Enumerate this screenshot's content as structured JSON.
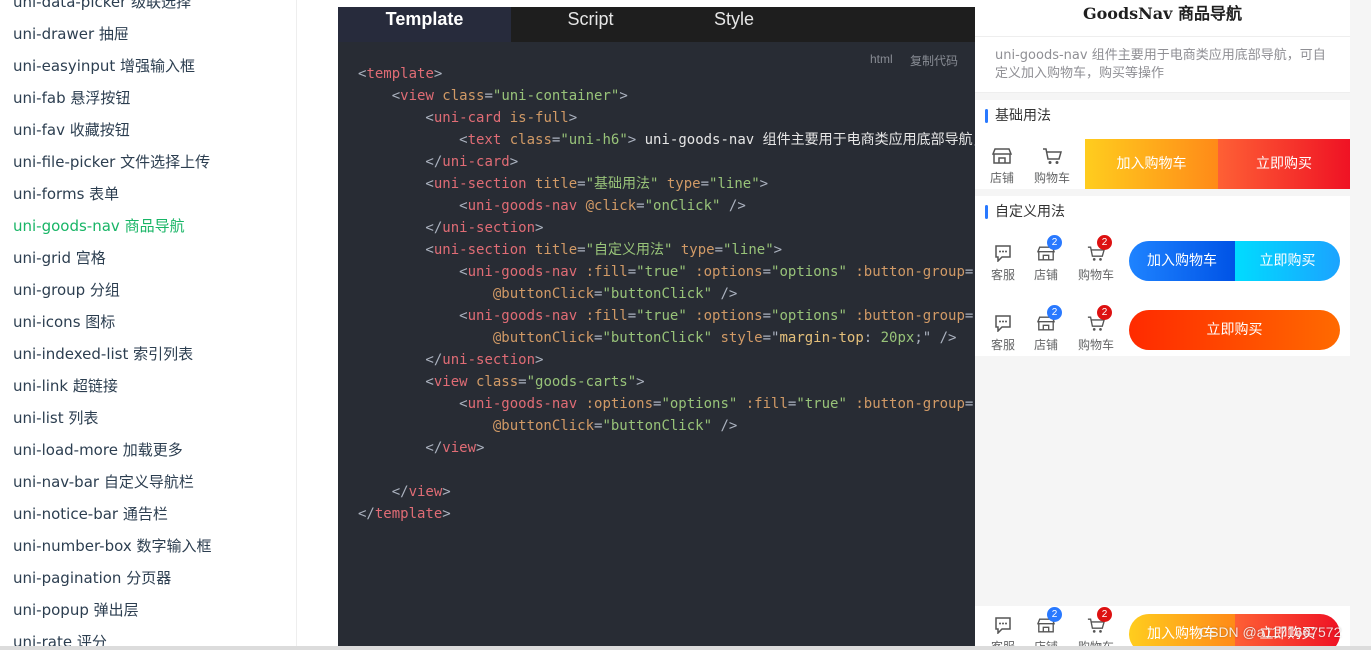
{
  "sidebar": {
    "items": [
      {
        "label": "uni-drawer 抽屉",
        "active": false
      },
      {
        "label": "uni-easyinput 增强输入框",
        "active": false
      },
      {
        "label": "uni-fab 悬浮按钮",
        "active": false
      },
      {
        "label": "uni-fav 收藏按钮",
        "active": false
      },
      {
        "label": "uni-file-picker 文件选择上传",
        "active": false
      },
      {
        "label": "uni-forms 表单",
        "active": false
      },
      {
        "label": "uni-goods-nav 商品导航",
        "active": true
      },
      {
        "label": "uni-grid 宫格",
        "active": false
      },
      {
        "label": "uni-group 分组",
        "active": false
      },
      {
        "label": "uni-icons 图标",
        "active": false
      },
      {
        "label": "uni-indexed-list 索引列表",
        "active": false
      },
      {
        "label": "uni-link 超链接",
        "active": false
      },
      {
        "label": "uni-list 列表",
        "active": false
      },
      {
        "label": "uni-load-more 加载更多",
        "active": false
      },
      {
        "label": "uni-nav-bar 自定义导航栏",
        "active": false
      },
      {
        "label": "uni-notice-bar 通告栏",
        "active": false
      },
      {
        "label": "uni-number-box 数字输入框",
        "active": false
      },
      {
        "label": "uni-pagination 分页器",
        "active": false
      },
      {
        "label": "uni-popup 弹出层",
        "active": false
      },
      {
        "label": "uni-rate 评分",
        "active": false
      }
    ]
  },
  "code_panel": {
    "tabs": [
      {
        "label": "Template",
        "active": true
      },
      {
        "label": "Script",
        "active": false
      },
      {
        "label": "Style",
        "active": false
      }
    ],
    "lang_label": "html",
    "copy_label": "复制代码",
    "lines": [
      [
        [
          "c-pun",
          "<"
        ],
        [
          "c-tag",
          "template"
        ],
        [
          "c-pun",
          ">"
        ]
      ],
      [
        [
          "c-pun",
          "    <"
        ],
        [
          "c-tag",
          "view"
        ],
        [
          "c-attr",
          " class"
        ],
        [
          "c-pun",
          "="
        ],
        [
          "c-str",
          "\"uni-container\""
        ],
        [
          "c-pun",
          ">"
        ]
      ],
      [
        [
          "c-pun",
          "        <"
        ],
        [
          "c-tag",
          "uni-card"
        ],
        [
          "c-attr",
          " is-full"
        ],
        [
          "c-pun",
          ">"
        ]
      ],
      [
        [
          "c-pun",
          "            <"
        ],
        [
          "c-tag",
          "text"
        ],
        [
          "c-attr",
          " class"
        ],
        [
          "c-pun",
          "="
        ],
        [
          "c-str",
          "\"uni-h6\""
        ],
        [
          "c-pun",
          ">"
        ],
        [
          "c-txt",
          " uni-goods-nav 组件主要用于电商类应用底部导航，"
        ]
      ],
      [
        [
          "c-pun",
          "        </"
        ],
        [
          "c-tag",
          "uni-card"
        ],
        [
          "c-pun",
          ">"
        ]
      ],
      [
        [
          "c-pun",
          "        <"
        ],
        [
          "c-tag",
          "uni-section"
        ],
        [
          "c-attr",
          " title"
        ],
        [
          "c-pun",
          "="
        ],
        [
          "c-str",
          "\"基础用法\""
        ],
        [
          "c-attr",
          " type"
        ],
        [
          "c-pun",
          "="
        ],
        [
          "c-str",
          "\"line\""
        ],
        [
          "c-pun",
          ">"
        ]
      ],
      [
        [
          "c-pun",
          "            <"
        ],
        [
          "c-tag",
          "uni-goods-nav"
        ],
        [
          "c-attr",
          " @click"
        ],
        [
          "c-pun",
          "="
        ],
        [
          "c-str",
          "\"onClick\""
        ],
        [
          "c-pun",
          " />"
        ]
      ],
      [
        [
          "c-pun",
          "        </"
        ],
        [
          "c-tag",
          "uni-section"
        ],
        [
          "c-pun",
          ">"
        ]
      ],
      [
        [
          "c-pun",
          "        <"
        ],
        [
          "c-tag",
          "uni-section"
        ],
        [
          "c-attr",
          " title"
        ],
        [
          "c-pun",
          "="
        ],
        [
          "c-str",
          "\"自定义用法\""
        ],
        [
          "c-attr",
          " type"
        ],
        [
          "c-pun",
          "="
        ],
        [
          "c-str",
          "\"line\""
        ],
        [
          "c-pun",
          ">"
        ]
      ],
      [
        [
          "c-pun",
          "            <"
        ],
        [
          "c-tag",
          "uni-goods-nav"
        ],
        [
          "c-attr",
          " :fill"
        ],
        [
          "c-pun",
          "="
        ],
        [
          "c-str",
          "\"true\""
        ],
        [
          "c-attr",
          " :options"
        ],
        [
          "c-pun",
          "="
        ],
        [
          "c-str",
          "\"options\""
        ],
        [
          "c-attr",
          " :button-group"
        ],
        [
          "c-pun",
          "="
        ]
      ],
      [
        [
          "c-attr",
          "                @buttonClick"
        ],
        [
          "c-pun",
          "="
        ],
        [
          "c-str",
          "\"buttonClick\""
        ],
        [
          "c-pun",
          " />"
        ]
      ],
      [
        [
          "c-pun",
          "            <"
        ],
        [
          "c-tag",
          "uni-goods-nav"
        ],
        [
          "c-attr",
          " :fill"
        ],
        [
          "c-pun",
          "="
        ],
        [
          "c-str",
          "\"true\""
        ],
        [
          "c-attr",
          " :options"
        ],
        [
          "c-pun",
          "="
        ],
        [
          "c-str",
          "\"options\""
        ],
        [
          "c-attr",
          " :button-group"
        ],
        [
          "c-pun",
          "="
        ]
      ],
      [
        [
          "c-attr",
          "                @buttonClick"
        ],
        [
          "c-pun",
          "="
        ],
        [
          "c-str",
          "\"buttonClick\""
        ],
        [
          "c-attr",
          " style"
        ],
        [
          "c-pun",
          "=\""
        ],
        [
          "c-yel",
          "margin-top"
        ],
        [
          "c-pun",
          ": "
        ],
        [
          "c-str",
          "20px"
        ],
        [
          "c-pun",
          ";\" />"
        ]
      ],
      [
        [
          "c-pun",
          "        </"
        ],
        [
          "c-tag",
          "uni-section"
        ],
        [
          "c-pun",
          ">"
        ]
      ],
      [
        [
          "c-pun",
          "        <"
        ],
        [
          "c-tag",
          "view"
        ],
        [
          "c-attr",
          " class"
        ],
        [
          "c-pun",
          "="
        ],
        [
          "c-str",
          "\"goods-carts\""
        ],
        [
          "c-pun",
          ">"
        ]
      ],
      [
        [
          "c-pun",
          "            <"
        ],
        [
          "c-tag",
          "uni-goods-nav"
        ],
        [
          "c-attr",
          " :options"
        ],
        [
          "c-pun",
          "="
        ],
        [
          "c-str",
          "\"options\""
        ],
        [
          "c-attr",
          " :fill"
        ],
        [
          "c-pun",
          "="
        ],
        [
          "c-str",
          "\"true\""
        ],
        [
          "c-attr",
          " :button-group"
        ],
        [
          "c-pun",
          "="
        ]
      ],
      [
        [
          "c-attr",
          "                @buttonClick"
        ],
        [
          "c-pun",
          "="
        ],
        [
          "c-str",
          "\"buttonClick\""
        ],
        [
          "c-pun",
          " />"
        ]
      ],
      [
        [
          "c-pun",
          "        </"
        ],
        [
          "c-tag",
          "view"
        ],
        [
          "c-pun",
          ">"
        ]
      ],
      [],
      [
        [
          "c-pun",
          "    </"
        ],
        [
          "c-tag",
          "view"
        ],
        [
          "c-pun",
          ">"
        ]
      ],
      [
        [
          "c-pun",
          "</"
        ],
        [
          "c-tag",
          "template"
        ],
        [
          "c-pun",
          ">"
        ]
      ]
    ]
  },
  "preview": {
    "nav_title": "GoodsNav 商品导航",
    "description": "uni-goods-nav 组件主要用于电商类应用底部导航，可自定义加入购物车，购买等操作",
    "section_basic": "基础用法",
    "section_custom": "自定义用法",
    "basic_nav": {
      "icons": [
        {
          "label": "店铺",
          "icon": "shop-icon"
        },
        {
          "label": "购物车",
          "icon": "cart-icon"
        }
      ],
      "buttons": [
        {
          "label": "加入购物车",
          "color": "#ffa200"
        },
        {
          "label": "立即购买",
          "color": "#ff0000"
        }
      ]
    },
    "custom_nav_1": {
      "icons": [
        {
          "label": "客服",
          "icon": "chat-icon"
        },
        {
          "label": "店铺",
          "icon": "shop-icon",
          "badge": "2"
        },
        {
          "label": "购物车",
          "icon": "cart-icon",
          "badge": "2"
        }
      ],
      "buttons": [
        {
          "label": "加入购物车",
          "color": "#0066cc"
        },
        {
          "label": "立即购买",
          "color": "#00b2ff"
        }
      ]
    },
    "custom_nav_2": {
      "icons": [
        {
          "label": "客服",
          "icon": "chat-icon"
        },
        {
          "label": "店铺",
          "icon": "shop-icon",
          "badge": "2"
        },
        {
          "label": "购物车",
          "icon": "cart-icon",
          "badge": "2"
        }
      ],
      "buttons": [
        {
          "label": "立即购买",
          "color": "#ff3300"
        }
      ]
    },
    "bottom_nav": {
      "icons": [
        {
          "label": "客服",
          "icon": "chat-icon"
        },
        {
          "label": "店铺",
          "icon": "shop-icon",
          "badge": "2"
        },
        {
          "label": "购物车",
          "icon": "cart-icon",
          "badge": "2"
        }
      ],
      "buttons": [
        {
          "label": "加入购物车",
          "color": "#ffa200"
        },
        {
          "label": "立即购买",
          "color": "#ff0000"
        }
      ]
    }
  },
  "watermark": "CSDN @a1171667572"
}
